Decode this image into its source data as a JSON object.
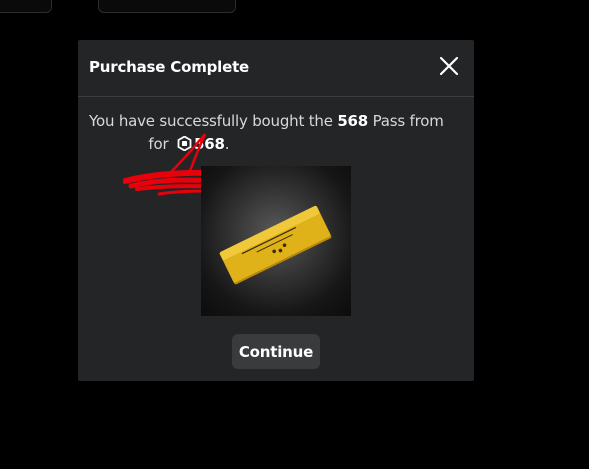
{
  "dialog": {
    "title": "Purchase Complete",
    "message": {
      "prefix": "You have successfully bought the ",
      "item_name": "568",
      "middle": " Pass from ",
      "seller_redacted": "            ",
      "for_text": " for ",
      "price": "568",
      "suffix": "."
    },
    "continue_label": "Continue",
    "currency_icon": "robux-icon",
    "close_icon": "close-icon",
    "image": "golden-ticket-pass-icon"
  },
  "colors": {
    "background": "#000000",
    "dialog_bg": "#232527",
    "button_bg": "#393b3d",
    "redaction": "#e8000b",
    "ticket_gold": "#e0b21a"
  }
}
